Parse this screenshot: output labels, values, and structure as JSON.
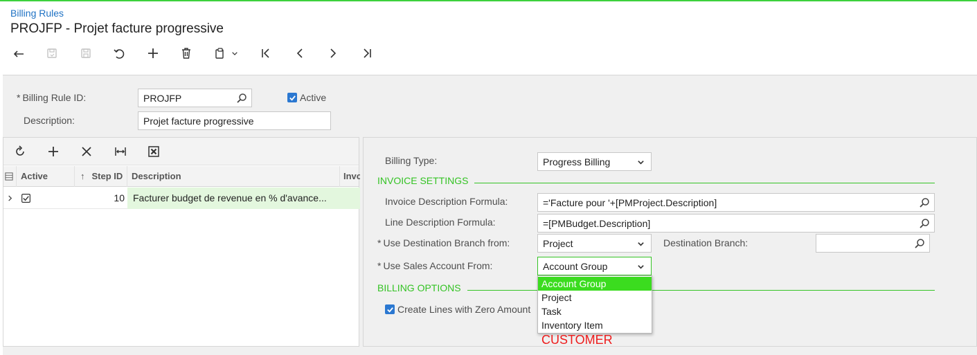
{
  "breadcrumb": "Billing Rules",
  "page_title": "PROJFP - Projet facture progressive",
  "toolbar": {
    "icons": [
      "back-icon",
      "save-close-icon",
      "save-icon",
      "undo-icon",
      "add-icon",
      "delete-icon",
      "clipboard-icon",
      "chevron-down-icon",
      "first-icon",
      "previous-icon",
      "next-icon",
      "last-icon"
    ]
  },
  "header": {
    "billing_rule_id_label": "Billing Rule ID:",
    "billing_rule_id_value": "PROJFP",
    "active_label": "Active",
    "active_checked": true,
    "description_label": "Description:",
    "description_value": "Projet facture progressive",
    "required_mark": "*"
  },
  "grid": {
    "toolbar_icons": [
      "refresh-icon",
      "add-icon",
      "delete-icon",
      "fit-columns-icon",
      "excel-export-icon"
    ],
    "columns": [
      "Active",
      "Step ID",
      "Description",
      "Invo"
    ],
    "sort_mark": "↑",
    "rows": [
      {
        "active": true,
        "step_id": "10",
        "description": "Facturer budget de revenue en % d'avance..."
      }
    ]
  },
  "details": {
    "billing_type_label": "Billing Type:",
    "billing_type_value": "Progress Billing",
    "invoice_settings_title": "INVOICE SETTINGS",
    "invoice_desc_formula_label": "Invoice Description Formula:",
    "invoice_desc_formula_value": "='Facture pour '+[PMProject.Description]",
    "line_desc_formula_label": "Line Description Formula:",
    "line_desc_formula_value": "=[PMBudget.Description]",
    "use_dest_branch_label": "Use Destination Branch from:",
    "use_dest_branch_value": "Project",
    "dest_branch_label": "Destination Branch:",
    "dest_branch_value": "",
    "use_sales_account_label": "Use Sales Account From:",
    "use_sales_account_value": "Account Group",
    "billing_options_title": "BILLING OPTIONS",
    "create_zero_label": "Create Lines with Zero Amount",
    "create_zero_checked": true
  },
  "sales_account_options": [
    "Account Group",
    "Project",
    "Task",
    "Inventory Item"
  ],
  "annotation": "CUSTOMER",
  "colors": {
    "accent_green": "#34c324",
    "selected_green": "#3bdc1f",
    "link_blue": "#1f72c4",
    "checkbox_blue": "#2b78d1",
    "annotation_red": "#ee1c1c"
  }
}
